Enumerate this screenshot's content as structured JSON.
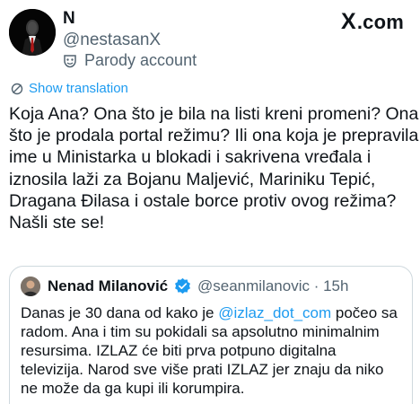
{
  "author": {
    "display_name": "N",
    "handle": "@nestasanX",
    "label": "Parody account"
  },
  "brand": {
    "x": "X",
    "domain": ".com"
  },
  "show_translation": "Show translation",
  "tweet_lines": [
    "Koja Ana? Ona što je bila na listi kreni promeni? Ona",
    "što je prodala portal režimu? Ili ona koja je prepravila",
    "ime u Ministarka u blokadi i sakrivena vređala i",
    "iznosila laži za Bojanu Maljević, Mariniku Tepić,",
    "Dragana Đilasa i ostale borce protiv ovog režima?",
    "Našli ste se!"
  ],
  "quote": {
    "name": "Nenad Milanović",
    "handle_time": "@seanmilanovic · 15h",
    "line1_before": "Danas je 30 dana od kako je ",
    "mention": "@izlaz_dot_com",
    "line1_after": " počeo sa",
    "lines": [
      "radom. Ana i tim su pokidali sa apsolutno minimalnim",
      "resursima. IZLAZ će biti prva potpuno digitalna",
      "televizija. Narod sve više prati IZLAZ jer znaju da niko",
      "ne može da ga kupi ili korumpira."
    ]
  },
  "colors": {
    "accent": "#1d9bf0",
    "text": "#0f1419",
    "muted": "#536471",
    "border": "#cfd9de"
  }
}
